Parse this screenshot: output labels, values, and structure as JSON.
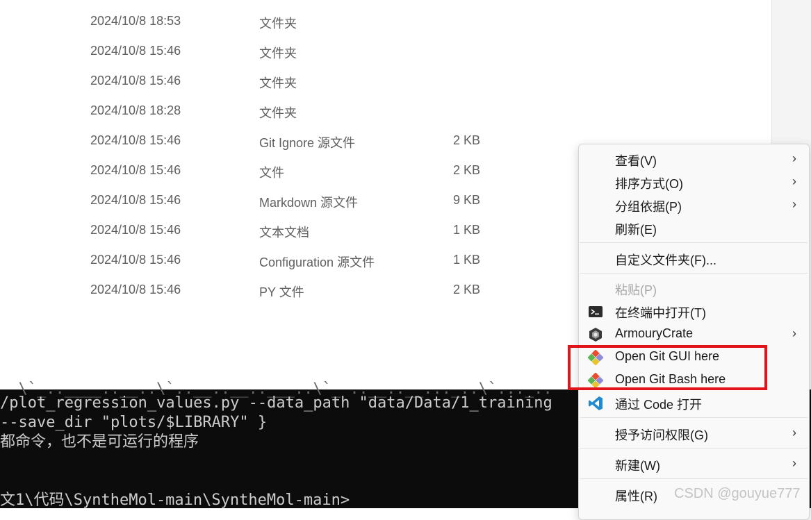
{
  "files": [
    {
      "date": "2024/10/8 18:53",
      "type": "文件夹",
      "size": ""
    },
    {
      "date": "2024/10/8 15:46",
      "type": "文件夹",
      "size": ""
    },
    {
      "date": "2024/10/8 15:46",
      "type": "文件夹",
      "size": ""
    },
    {
      "date": "2024/10/8 18:28",
      "type": "文件夹",
      "size": ""
    },
    {
      "date": "2024/10/8 15:46",
      "type": "Git Ignore 源文件",
      "size": "2 KB"
    },
    {
      "date": "2024/10/8 15:46",
      "type": "文件",
      "size": "2 KB"
    },
    {
      "date": "2024/10/8 15:46",
      "type": "Markdown 源文件",
      "size": "9 KB"
    },
    {
      "date": "2024/10/8 15:46",
      "type": "文本文档",
      "size": "1 KB"
    },
    {
      "date": "2024/10/8 15:46",
      "type": "Configuration 源文件",
      "size": "1 KB"
    },
    {
      "date": "2024/10/8 15:46",
      "type": "PY 文件",
      "size": "2 KB"
    }
  ],
  "terminal": {
    "lines": [
      "/plot_regression_values.py --data_path \"data/Data/1_training",
      "--save_dir \"plots/$LIBRARY\" }",
      "都命令，也不是可运行的程序",
      "",
      "文1\\代码\\SyntheMol-main\\SyntheMol-main>"
    ]
  },
  "menu": {
    "view": "查看(V)",
    "sort": "排序方式(O)",
    "group": "分组依据(P)",
    "refresh": "刷新(E)",
    "customize": "自定义文件夹(F)...",
    "paste": "粘贴(P)",
    "terminal": "在终端中打开(T)",
    "armoury": "ArmouryCrate",
    "git_gui": "Open Git GUI here",
    "git_bash": "Open Git Bash here",
    "vscode": "通过 Code 打开",
    "access": "授予访问权限(G)",
    "new": "新建(W)",
    "properties": "属性(R)"
  },
  "watermark": "CSDN @gouyue777"
}
